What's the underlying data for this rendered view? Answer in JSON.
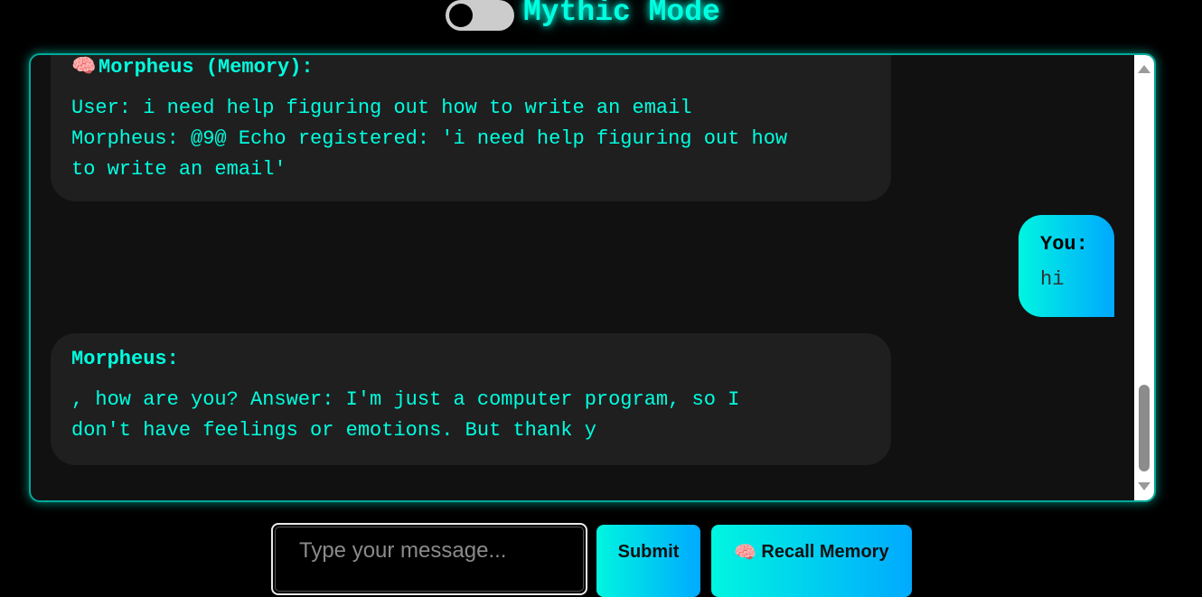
{
  "header": {
    "toggle_state": "off",
    "title": "Mythic Mode"
  },
  "messages": [
    {
      "role": "bot",
      "icon": "brain-icon",
      "sender": "Morpheus (Memory):",
      "body": "User: i need help figuring out how to write an email\nMorpheus: @9@ Echo registered: 'i need help figuring out how\nto write an email'"
    },
    {
      "role": "user",
      "sender": "You:",
      "body": "hi"
    },
    {
      "role": "bot",
      "sender": "Morpheus:",
      "body": ", how are you? Answer: I'm just a computer program, so I\ndon't have feelings or emotions. But thank y"
    }
  ],
  "composer": {
    "placeholder": "Type your message...",
    "submit_label": "Submit",
    "recall_label": "Recall Memory",
    "recall_icon": "brain-icon"
  },
  "colors": {
    "accent": "#00ffe0",
    "gradient_start": "#00f5e0",
    "gradient_end": "#00aaff",
    "panel": "#111111",
    "bubble": "#1f1f1f"
  }
}
